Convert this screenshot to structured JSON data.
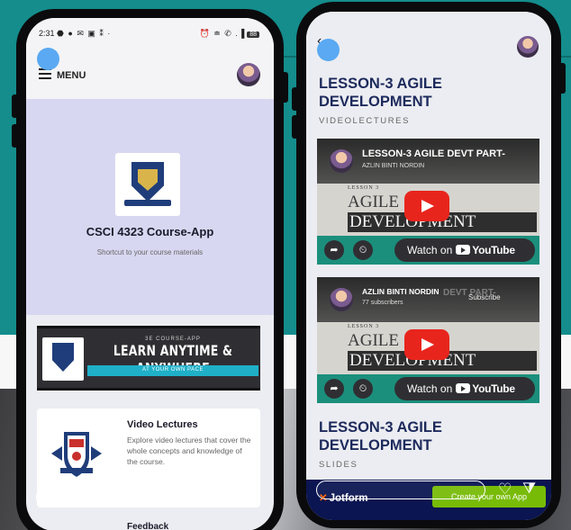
{
  "colors": {
    "teal": "#148d8c",
    "hero_lavender": "#d8d7f1",
    "lesson_title_navy": "#1d2a5c",
    "youtube_red": "#e8251d",
    "jotform_navy": "#0a1551",
    "jotform_green": "#78bb07"
  },
  "left_phone": {
    "status": {
      "time": "2:31",
      "left_icons": "⬣ ● ✉ ▣ ⁑ ·",
      "right_icons": "⏰ ≐ ✆ .▐",
      "battery": "88"
    },
    "menu_label": "MENU",
    "hero": {
      "title": "CSCI 4323 Course-App",
      "subtitle": "Shortcut to your course materials"
    },
    "banner": {
      "top_text": "3E COURSE-APP",
      "main_text": "LEARN ANYTIME & ANYWHERE",
      "sub_text": "AT YOUR OWN PACE"
    },
    "card": {
      "title": "Video Lectures",
      "description": "Explore video lectures that cover the whole concepts and knowledge of the course."
    },
    "next_item_partial": "Feedback"
  },
  "right_phone": {
    "back_glyph": "‹",
    "section1": {
      "title": "LESSON-3 AGILE DEVELOPMENT",
      "label": "VIDEOLECTURES"
    },
    "video1": {
      "title": "LESSON-3 AGILE DEVT PART-",
      "channel": "AZLIN BINTI NORDIN",
      "thumb_small": "LESSON 3",
      "thumb_line1": "AGILE",
      "thumb_line2": "DEVELOPMENT",
      "watch_on": "Watch on",
      "youtube": "YouTube"
    },
    "video2": {
      "channel": "AZLIN BINTI NORDIN",
      "subscribers": "77 subscribers",
      "subscribe": "Subscribe",
      "ghost_title": "DEVT PART-",
      "thumb_small": "LESSON 3",
      "thumb_line1": "AGILE",
      "thumb_line2": "DEVELOPMENT",
      "watch_on": "Watch on",
      "youtube": "YouTube"
    },
    "section2": {
      "title": "LESSON-3 AGILE DEVELOPMENT",
      "label": "SLIDES"
    },
    "jotform": {
      "logo": "Jotform",
      "cta": "Create your own App"
    }
  },
  "icons": {
    "share": "➦",
    "clock": "⏲",
    "heart": "♡",
    "filter": "⧩"
  }
}
